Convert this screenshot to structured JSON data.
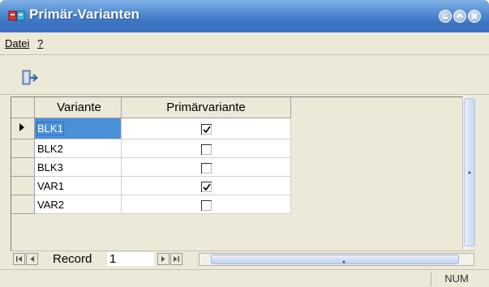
{
  "window": {
    "title": "Primär-Varianten"
  },
  "menu": {
    "items": [
      {
        "label": "Datei"
      },
      {
        "label": "?"
      }
    ]
  },
  "toolbar": {
    "exit_icon": "exit-door-icon"
  },
  "grid": {
    "columns": [
      "Variante",
      "Primärvariante"
    ],
    "rows": [
      {
        "variante": "BLK1",
        "primaer": true,
        "selected": true
      },
      {
        "variante": "BLK2",
        "primaer": false
      },
      {
        "variante": "BLK3",
        "primaer": false
      },
      {
        "variante": "VAR1",
        "primaer": true
      },
      {
        "variante": "VAR2",
        "primaer": false
      }
    ]
  },
  "navigator": {
    "label": "Record",
    "current": "1"
  },
  "status": {
    "num": "NUM"
  },
  "colors": {
    "title_bar": "#3d74c2",
    "selection": "#4a90d9",
    "face": "#ece9d8"
  }
}
